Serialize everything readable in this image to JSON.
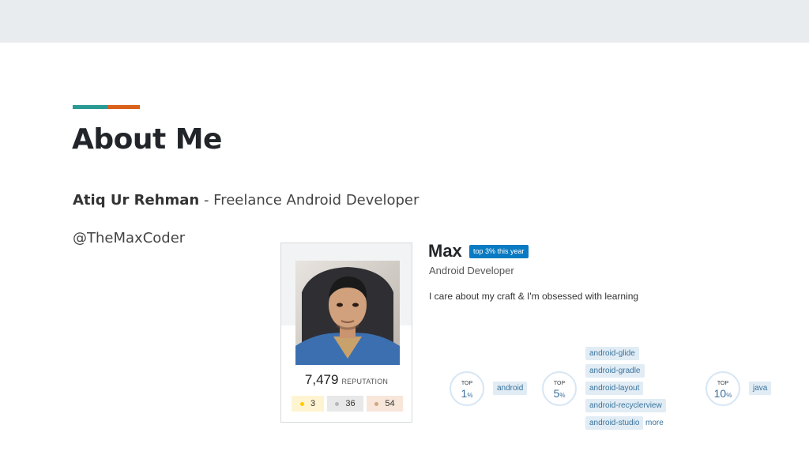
{
  "slide": {
    "title": "About Me",
    "name": "Atiq Ur Rehman",
    "separator": " - ",
    "role": "Freelance Android Developer",
    "handle": "@TheMaxCoder"
  },
  "colors": {
    "teal": "#2a9a94",
    "orange": "#d9611c",
    "tag_bg": "#e1ecf4",
    "tag_text": "#39739d",
    "badge_blue": "#0a7bc2"
  },
  "profile": {
    "avatar_icon": "profile-photo",
    "reputation": "7,479",
    "reputation_label": "REPUTATION",
    "badges": {
      "gold": "3",
      "silver": "36",
      "bronze": "54"
    },
    "display_name": "Max",
    "top_badge": "top 3% this year",
    "title": "Android Developer",
    "bio": "I care about my craft & I'm obsessed with learning",
    "tag_groups": [
      {
        "top_label": "TOP",
        "percent": "1",
        "unit": "%",
        "tags": [
          "android"
        ]
      },
      {
        "top_label": "TOP",
        "percent": "5",
        "unit": "%",
        "tags": [
          "android-glide",
          "android-gradle",
          "android-layout",
          "android-recyclerview",
          "android-studio"
        ],
        "more": "more"
      },
      {
        "top_label": "TOP",
        "percent": "10",
        "unit": "%",
        "tags": [
          "java"
        ]
      }
    ]
  }
}
